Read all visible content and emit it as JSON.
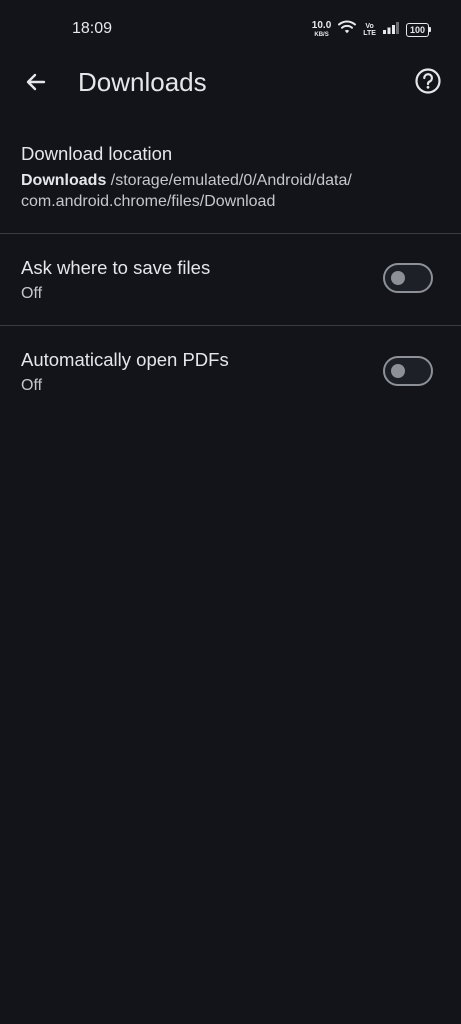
{
  "status_bar": {
    "time": "18:09",
    "net_speed_value": "10.0",
    "net_speed_unit": "KB/S",
    "volte_top": "Vo",
    "volte_bottom": "LTE",
    "battery": "100",
    "icons": [
      "wifi-icon",
      "volte-icon",
      "signal-icon",
      "battery-icon"
    ]
  },
  "app_bar": {
    "title": "Downloads",
    "back_icon": "arrow-back-icon",
    "help_icon": "help-circle-icon"
  },
  "settings": {
    "download_location": {
      "title": "Download location",
      "folder": "Downloads",
      "path_line1": " /storage/emulated/0/Android/data/",
      "path_line2": "com.android.chrome/files/Download"
    },
    "ask_where": {
      "title": "Ask where to save files",
      "summary": "Off",
      "enabled": false
    },
    "auto_open_pdfs": {
      "title": "Automatically open PDFs",
      "summary": "Off",
      "enabled": false
    }
  },
  "colors": {
    "background": "#12141a",
    "text_primary": "#e6e6e9",
    "text_secondary": "#c6c7cc",
    "divider": "#3a3c43",
    "toggle_off": "#8d9096"
  }
}
